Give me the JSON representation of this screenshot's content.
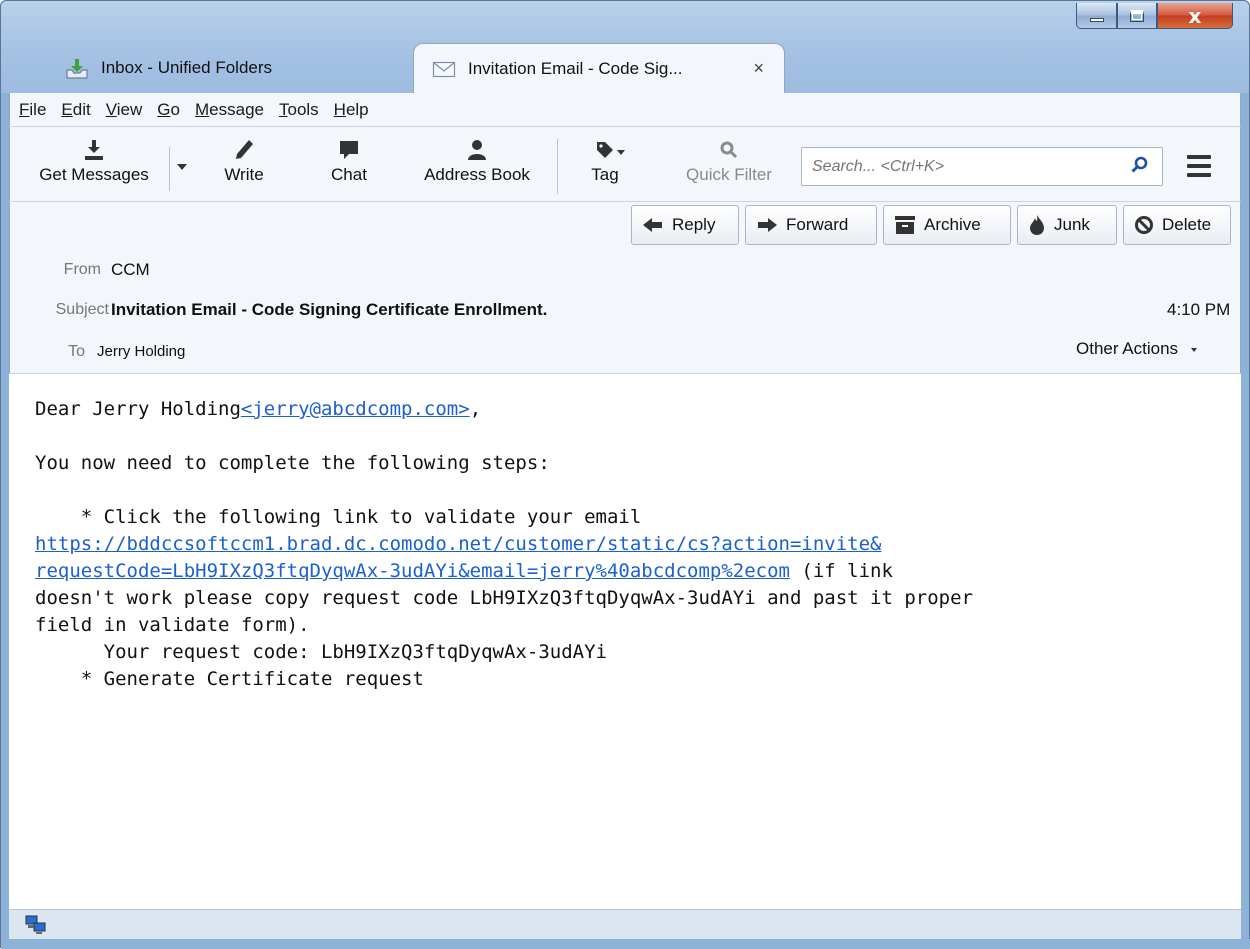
{
  "window": {
    "controls": {
      "close_glyph": "x"
    }
  },
  "tabs": [
    {
      "label": "Inbox - Unified Folders",
      "icon": "inbox-download-icon"
    },
    {
      "label": "Invitation Email - Code Sig...",
      "icon": "envelope-icon",
      "close_glyph": "×"
    }
  ],
  "menubar": [
    "File",
    "Edit",
    "View",
    "Go",
    "Message",
    "Tools",
    "Help"
  ],
  "toolbar": {
    "get_messages": "Get Messages",
    "write": "Write",
    "chat": "Chat",
    "address_book": "Address Book",
    "tag": "Tag",
    "quick_filter": "Quick Filter",
    "search_placeholder": "Search... <Ctrl+K>"
  },
  "actions": {
    "reply": "Reply",
    "forward": "Forward",
    "archive": "Archive",
    "junk": "Junk",
    "delete": "Delete"
  },
  "header": {
    "from_label": "From",
    "from_value": "CCM",
    "subject_label": "Subject",
    "subject_value": "Invitation Email - Code Signing Certificate Enrollment.",
    "time": "4:10 PM",
    "to_label": "To",
    "to_value": "Jerry Holding",
    "other_actions": "Other Actions"
  },
  "body": {
    "greeting_name": "Dear Jerry Holding",
    "email_link": "<jerry@abcdcomp.com>",
    "greeting_end": ",",
    "steps_intro": "You now need to complete the following steps:",
    "step1": "    * Click the following link to validate your email",
    "link_line1": "https://bddccsoftccm1.brad.dc.comodo.net/customer/static/cs?action=invite&",
    "link_line2": "requestCode=LbH9IXzQ3ftqDyqwAx-3udAYi&email=jerry%40abcdcomp%2ecom",
    "after_link": " (if link",
    "line_doesnt": "doesn't work please copy request code LbH9IXzQ3ftqDyqwAx-3udAYi and past it proper",
    "line_field": "field in validate form).",
    "request_code_line": "      Your request code: LbH9IXzQ3ftqDyqwAx-3udAYi",
    "step2": "    * Generate Certificate request"
  },
  "colors": {
    "link": "#1b5fd1",
    "title_bar": "#a5c2e3",
    "close_button": "#c23c1d"
  }
}
